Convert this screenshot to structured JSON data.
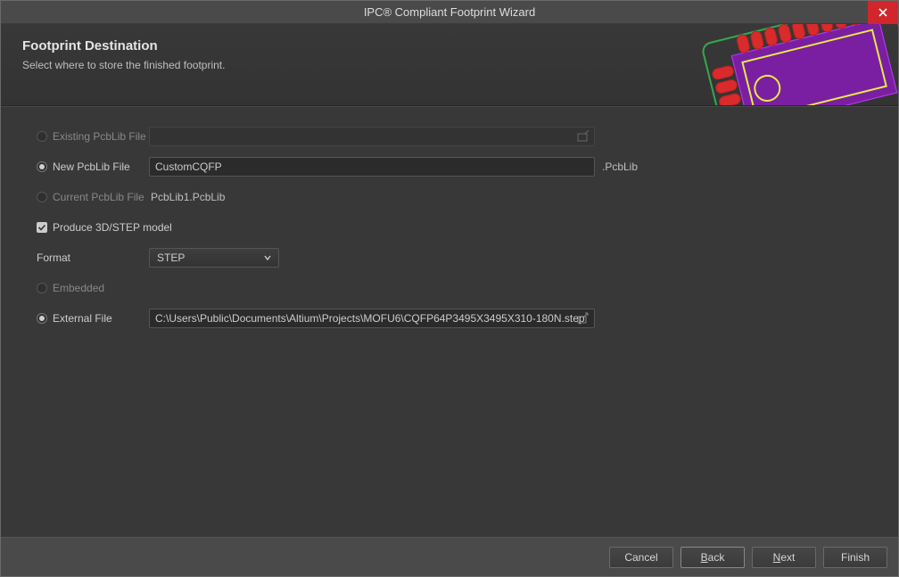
{
  "titlebar": {
    "title": "IPC® Compliant Footprint Wizard"
  },
  "header": {
    "title": "Footprint Destination",
    "subtitle": "Select where to store the finished footprint."
  },
  "options": {
    "existing_label": "Existing PcbLib File",
    "existing_value": "",
    "new_label": "New PcbLib File",
    "new_value": "CustomCQFP",
    "new_suffix": ".PcbLib",
    "current_label": "Current PcbLib File",
    "current_value": "PcbLib1.PcbLib",
    "produce3d_label": "Produce 3D/STEP model",
    "format_label": "Format",
    "format_value": "STEP",
    "embedded_label": "Embedded",
    "external_label": "External File",
    "external_value": "C:\\Users\\Public\\Documents\\Altium\\Projects\\MOFU6\\CQFP64P3495X3495X310-180N.step"
  },
  "buttons": {
    "cancel": "Cancel",
    "back": "Back",
    "next": "Next",
    "finish": "Finish"
  },
  "state": {
    "destination_selected": "new",
    "produce3d_checked": true,
    "model_location_selected": "external"
  }
}
